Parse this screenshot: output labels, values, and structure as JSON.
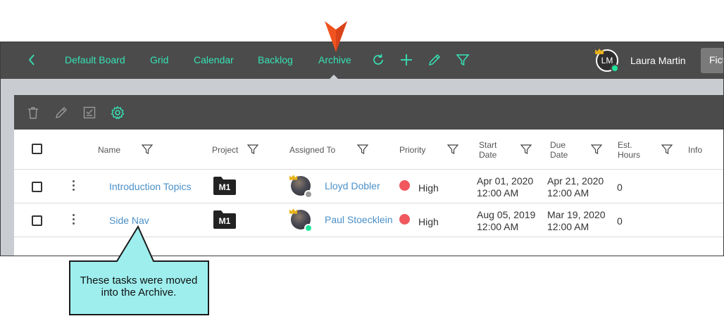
{
  "colors": {
    "accent": "#36e3b5",
    "topbar": "#4b4b4b",
    "link": "#4a90c8",
    "pointer": "#f0531f",
    "callout_fill": "#9eeeee",
    "priority_high": "#f0585e"
  },
  "nav": {
    "back_icon": "chevron-left-icon",
    "links": [
      "Default Board",
      "Grid",
      "Calendar",
      "Backlog",
      "Archive"
    ],
    "active": "Archive",
    "icons": [
      "refresh-icon",
      "plus-icon",
      "pencil-icon",
      "filter-icon"
    ]
  },
  "user": {
    "initials": "LM",
    "name": "Laura Martin",
    "status": "online"
  },
  "board_selector": {
    "label": "Ficti"
  },
  "toolbar": {
    "icons": [
      "trash-icon",
      "pencil-icon",
      "checklist-icon",
      "gear-icon"
    ]
  },
  "table": {
    "headers": {
      "name": "Name",
      "project": "Project",
      "assigned": "Assigned To",
      "priority": "Priority",
      "start_1": "Start",
      "start_2": "Date",
      "due_1": "Due",
      "due_2": "Date",
      "est_1": "Est.",
      "est_2": "Hours",
      "info": "Info"
    },
    "rows": [
      {
        "name": "Introduction Topics",
        "project": "M1",
        "assignee": "Lloyd Dobler",
        "assignee_status": "away",
        "priority": "High",
        "start_date": "Apr 01, 2020",
        "start_time": "12:00 AM",
        "due_date": "Apr 21, 2020",
        "due_time": "12:00 AM",
        "hours": "0"
      },
      {
        "name": "Side Nav",
        "project": "M1",
        "assignee": "Paul Stoecklein",
        "assignee_status": "online",
        "priority": "High",
        "start_date": "Aug 05, 2019",
        "start_time": "12:00 AM",
        "due_date": "Mar 19, 2020",
        "due_time": "12:00 AM",
        "hours": "0"
      }
    ]
  },
  "callout": {
    "line1": "These tasks were moved",
    "line2": "into the Archive."
  }
}
